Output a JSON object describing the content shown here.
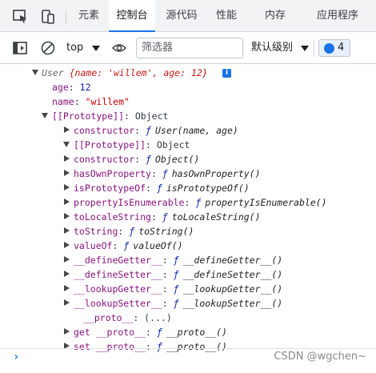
{
  "tabs": {
    "elements": "元素",
    "console": "控制台",
    "sources": "源代码",
    "performance": "性能",
    "memory": "内存",
    "application": "应用程序"
  },
  "toolbar": {
    "context": "top",
    "filter_placeholder": "筛选器",
    "level": "默认级别",
    "messages_count": "4"
  },
  "console": {
    "summary_prefix": "User ",
    "summary_obj": "{name: 'willem', age: 12}",
    "info_glyph": "i",
    "age_key": "age",
    "age_val": "12",
    "name_key": "name",
    "name_val": "\"willem\"",
    "proto1_key": "[[Prototype]]",
    "proto1_val": "Object",
    "constructor_key": "constructor",
    "constructor_val": "User(name, age)",
    "proto2_key": "[[Prototype]]",
    "proto2_val": "Object",
    "proto2_items": [
      {
        "key": "constructor",
        "val": "Object()"
      },
      {
        "key": "hasOwnProperty",
        "val": "hasOwnProperty()"
      },
      {
        "key": "isPrototypeOf",
        "val": "isPrototypeOf()"
      },
      {
        "key": "propertyIsEnumerable",
        "val": "propertyIsEnumerable()"
      },
      {
        "key": "toLocaleString",
        "val": "toLocaleString()"
      },
      {
        "key": "toString",
        "val": "toString()"
      },
      {
        "key": "valueOf",
        "val": "valueOf()"
      },
      {
        "key": "__defineGetter__",
        "val": "__defineGetter__()"
      },
      {
        "key": "__defineSetter__",
        "val": "__defineSetter__()"
      },
      {
        "key": "__lookupGetter__",
        "val": "__lookupGetter__()"
      },
      {
        "key": "__lookupSetter__",
        "val": "__lookupSetter__()"
      }
    ],
    "proto_key": "__proto__",
    "proto_val": "(...)",
    "get_proto_key": "get __proto__",
    "get_proto_val": "__proto__()",
    "set_proto_key": "set __proto__",
    "set_proto_val": "__proto__()",
    "fn_keyword": "ƒ",
    "prompt": "›"
  },
  "watermark": "CSDN @wgchen~",
  "colors": {
    "accent": "#1a73e8",
    "key": "#881280",
    "string": "#c80000",
    "number": "#1a1aa6"
  }
}
